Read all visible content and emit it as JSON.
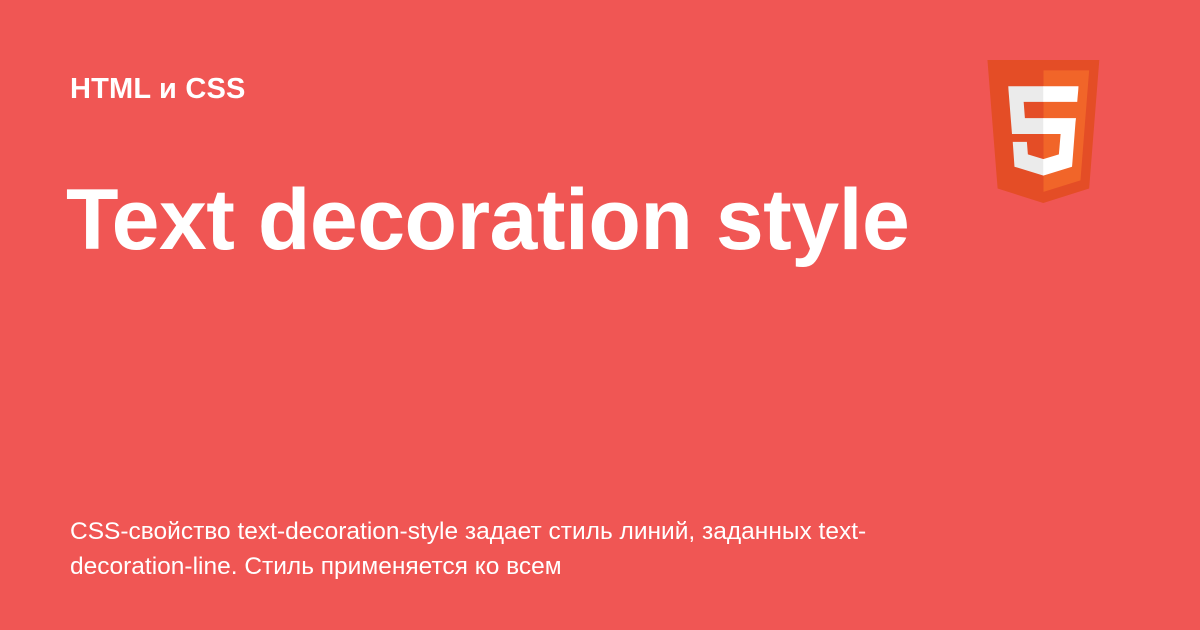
{
  "card": {
    "category": "HTML и CSS",
    "title": "Text decoration style",
    "description": "CSS-свойство text-decoration-style задает стиль линий, заданных text-decoration-line. Стиль применяется ко всем",
    "logo_icon": "html5-icon"
  },
  "colors": {
    "background": "#f05654",
    "text": "#ffffff",
    "logo_dark": "#e44d26",
    "logo_light": "#f16529",
    "logo_shield_bright": "#ffffff",
    "logo_shield_dim": "#ebebeb"
  }
}
